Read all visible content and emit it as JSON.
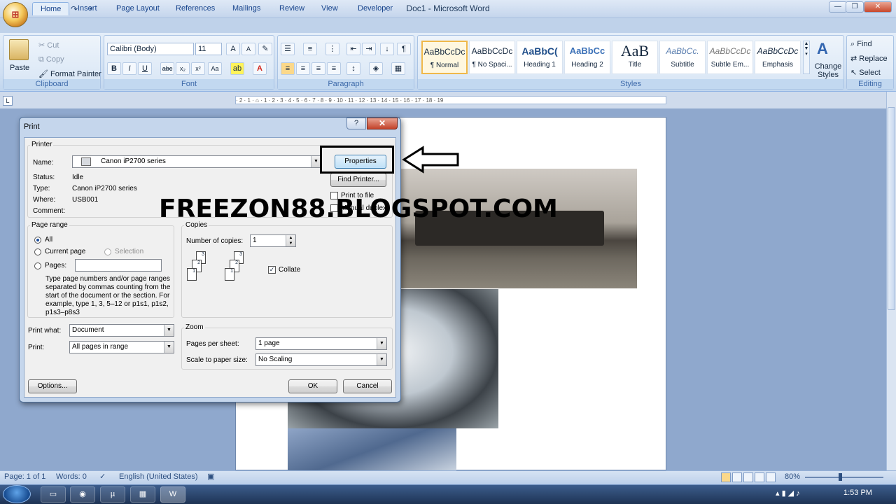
{
  "app": {
    "title": "Doc1 - Microsoft Word"
  },
  "tabs": [
    "Home",
    "Insert",
    "Page Layout",
    "References",
    "Mailings",
    "Review",
    "View",
    "Developer"
  ],
  "ribbon": {
    "clipboard": {
      "paste": "Paste",
      "cut": "Cut",
      "copy": "Copy",
      "format_painter": "Format Painter",
      "label": "Clipboard"
    },
    "font": {
      "name": "Calibri (Body)",
      "size": "11",
      "label": "Font"
    },
    "paragraph": {
      "label": "Paragraph"
    },
    "styles": {
      "items": [
        {
          "sample": "AaBbCcDc",
          "name": "¶ Normal"
        },
        {
          "sample": "AaBbCcDc",
          "name": "¶ No Spaci..."
        },
        {
          "sample": "AaBbC(",
          "name": "Heading 1"
        },
        {
          "sample": "AaBbCc",
          "name": "Heading 2"
        },
        {
          "sample": "AaB",
          "name": "Title"
        },
        {
          "sample": "AaBbCc.",
          "name": "Subtitle"
        },
        {
          "sample": "AaBbCcDc",
          "name": "Subtle Em..."
        },
        {
          "sample": "AaBbCcDc",
          "name": "Emphasis"
        }
      ],
      "change_styles": "Change Styles",
      "label": "Styles"
    },
    "editing": {
      "find": "Find",
      "replace": "Replace",
      "select": "Select",
      "label": "Editing"
    }
  },
  "ruler": {
    "text": "· 2 · 1 · ⌂ · 1 · 2 · 3 · 4 · 5 · 6 · 7 · 8 · 9 · 10 · 11 · 12 · 13 · 14 · 15 · 16 · 17 · 18 · 19"
  },
  "dialog": {
    "title": "Print",
    "help": "?",
    "close": "✕",
    "printer": {
      "group": "Printer",
      "name_label": "Name:",
      "name_value": "Canon iP2700 series",
      "status_label": "Status:",
      "status_value": "Idle",
      "type_label": "Type:",
      "type_value": "Canon iP2700 series",
      "where_label": "Where:",
      "where_value": "USB001",
      "comment_label": "Comment:",
      "properties": "Properties",
      "find_printer": "Find Printer...",
      "print_to_file": "Print to file",
      "manual_duplex": "Manual duplex"
    },
    "page_range": {
      "group": "Page range",
      "all": "All",
      "current_page": "Current page",
      "selection": "Selection",
      "pages": "Pages:",
      "help_text": "Type page numbers and/or page ranges separated by commas counting from the start of the document or the section. For example, type 1, 3, 5–12 or p1s1, p1s2, p1s3–p8s3"
    },
    "copies": {
      "group": "Copies",
      "number_label": "Number of copies:",
      "number_value": "1",
      "collate": "Collate"
    },
    "print_what": {
      "label": "Print what:",
      "value": "Document"
    },
    "print": {
      "label": "Print:",
      "value": "All pages in range"
    },
    "zoom": {
      "group": "Zoom",
      "pps_label": "Pages per sheet:",
      "pps_value": "1 page",
      "scale_label": "Scale to paper size:",
      "scale_value": "No Scaling"
    },
    "options": "Options...",
    "ok": "OK",
    "cancel": "Cancel"
  },
  "watermark": "FREEZON88.BLOGSPOT.COM",
  "status": {
    "page": "Page: 1 of 1",
    "words": "Words: 0",
    "language": "English (United States)",
    "zoom": "80%"
  },
  "taskbar": {
    "clock": "1:53 PM"
  }
}
